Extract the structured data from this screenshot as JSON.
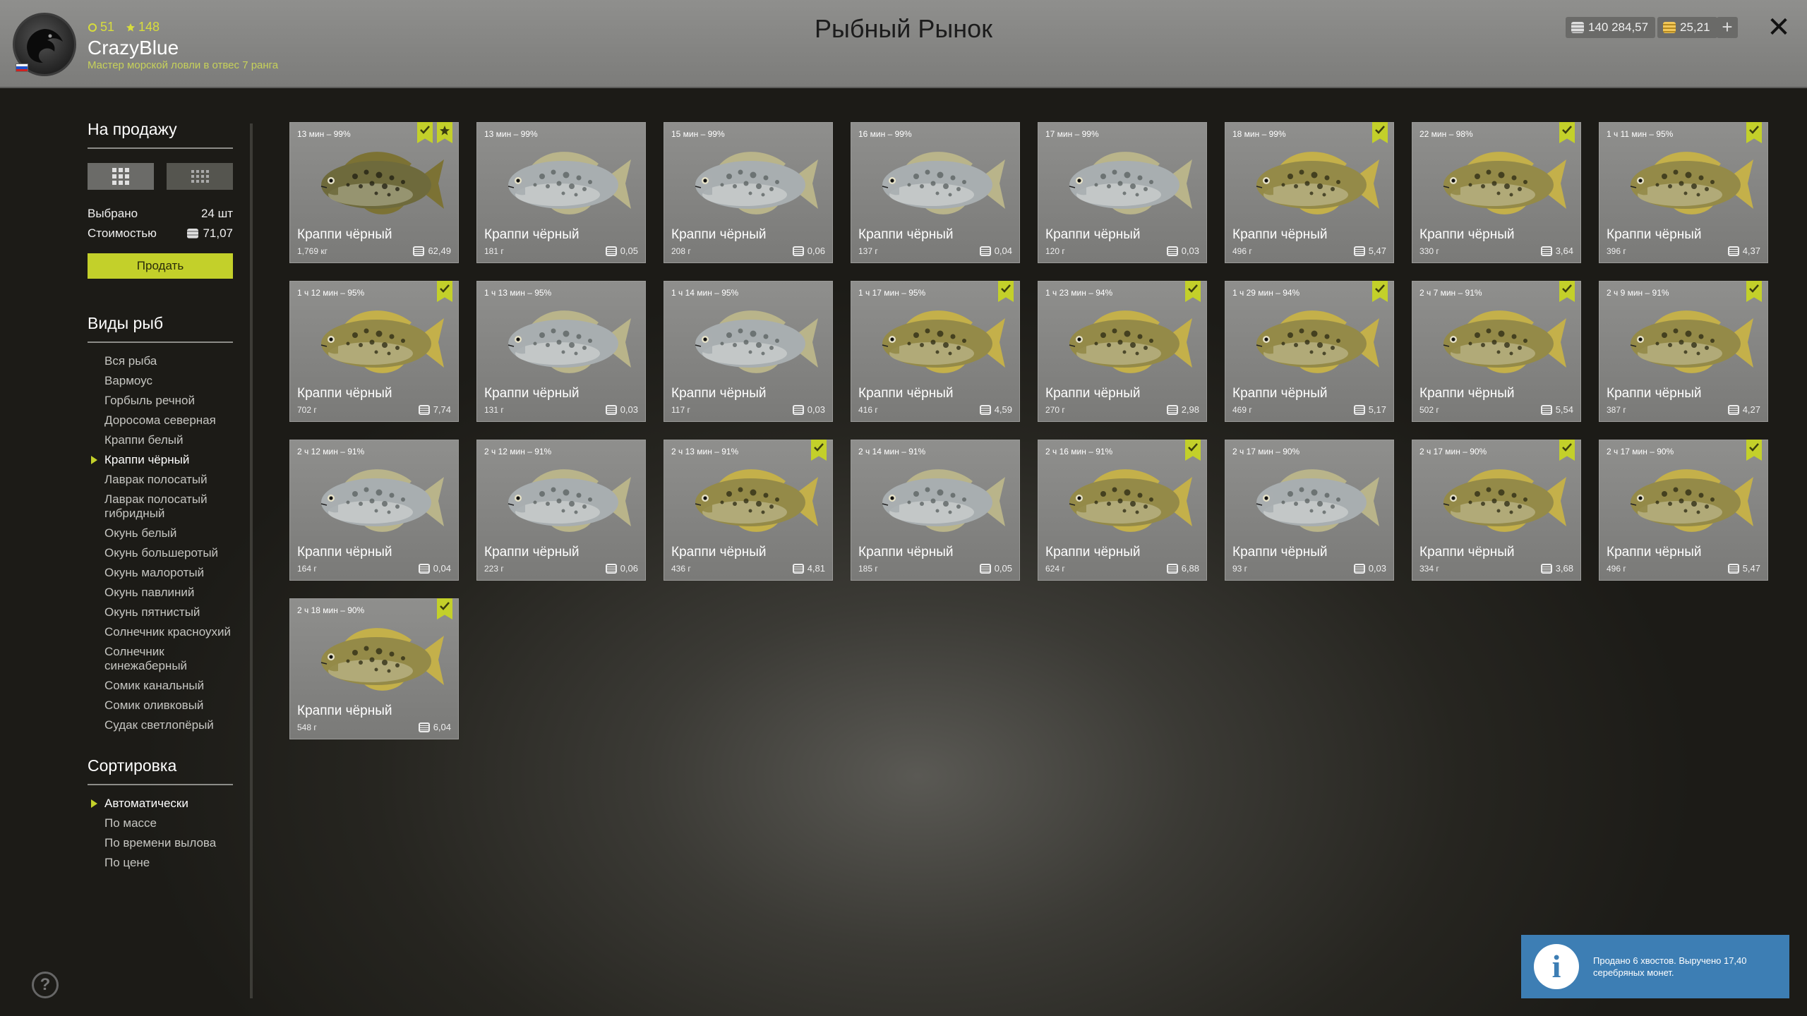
{
  "header": {
    "title": "Рыбный Рынок",
    "username": "CrazyBlue",
    "rank_text": "Мастер морской ловли в отвес 7 ранга",
    "level": "51",
    "stars": "148",
    "silver": "140 284,57",
    "gold": "25,21",
    "plus_label": "+",
    "close_label": "✕"
  },
  "sidebar": {
    "for_sale_title": "На продажу",
    "selected_label": "Выбрано",
    "selected_value": "24 шт",
    "cost_label": "Стоимостью",
    "cost_value": "71,07",
    "sell_label": "Продать",
    "species_title": "Виды рыб",
    "species": [
      {
        "label": "Вся рыба",
        "active": false
      },
      {
        "label": "Вармоус",
        "active": false
      },
      {
        "label": "Горбыль речной",
        "active": false
      },
      {
        "label": "Доросома северная",
        "active": false
      },
      {
        "label": "Краппи белый",
        "active": false
      },
      {
        "label": "Краппи чёрный",
        "active": true
      },
      {
        "label": "Лаврак полосатый",
        "active": false
      },
      {
        "label": "Лаврак полосатый гибридный",
        "active": false
      },
      {
        "label": "Окунь белый",
        "active": false
      },
      {
        "label": "Окунь большеротый",
        "active": false
      },
      {
        "label": "Окунь малоротый",
        "active": false
      },
      {
        "label": "Окунь павлиний",
        "active": false
      },
      {
        "label": "Окунь пятнистый",
        "active": false
      },
      {
        "label": "Солнечник красноухий",
        "active": false
      },
      {
        "label": "Солнечник синежаберный",
        "active": false
      },
      {
        "label": "Сомик канальный",
        "active": false
      },
      {
        "label": "Сомик оливковый",
        "active": false
      },
      {
        "label": "Судак светлопёрый",
        "active": false
      }
    ],
    "sort_title": "Сортировка",
    "sort": [
      {
        "label": "Автоматически",
        "active": true
      },
      {
        "label": "По массе",
        "active": false
      },
      {
        "label": "По времени вылова",
        "active": false
      },
      {
        "label": "По цене",
        "active": false
      }
    ],
    "help_label": "?"
  },
  "fish": [
    {
      "time": "13 мин – 99%",
      "name": "Краппи чёрный",
      "weight": "1,769 кг",
      "price": "62,49",
      "checked": true,
      "star": true,
      "color": "dark"
    },
    {
      "time": "13 мин – 99%",
      "name": "Краппи чёрный",
      "weight": "181 г",
      "price": "0,05",
      "checked": false,
      "star": false,
      "color": "pale"
    },
    {
      "time": "15 мин – 99%",
      "name": "Краппи чёрный",
      "weight": "208 г",
      "price": "0,06",
      "checked": false,
      "star": false,
      "color": "pale"
    },
    {
      "time": "16 мин – 99%",
      "name": "Краппи чёрный",
      "weight": "137 г",
      "price": "0,04",
      "checked": false,
      "star": false,
      "color": "pale"
    },
    {
      "time": "17 мин – 99%",
      "name": "Краппи чёрный",
      "weight": "120 г",
      "price": "0,03",
      "checked": false,
      "star": false,
      "color": "pale"
    },
    {
      "time": "18 мин – 99%",
      "name": "Краппи чёрный",
      "weight": "496 г",
      "price": "5,47",
      "checked": true,
      "star": false,
      "color": "gold"
    },
    {
      "time": "22 мин – 98%",
      "name": "Краппи чёрный",
      "weight": "330 г",
      "price": "3,64",
      "checked": true,
      "star": false,
      "color": "gold"
    },
    {
      "time": "1 ч 11 мин – 95%",
      "name": "Краппи чёрный",
      "weight": "396 г",
      "price": "4,37",
      "checked": true,
      "star": false,
      "color": "gold"
    },
    {
      "time": "1 ч 12 мин – 95%",
      "name": "Краппи чёрный",
      "weight": "702 г",
      "price": "7,74",
      "checked": true,
      "star": false,
      "color": "gold"
    },
    {
      "time": "1 ч 13 мин – 95%",
      "name": "Краппи чёрный",
      "weight": "131 г",
      "price": "0,03",
      "checked": false,
      "star": false,
      "color": "pale"
    },
    {
      "time": "1 ч 14 мин – 95%",
      "name": "Краппи чёрный",
      "weight": "117 г",
      "price": "0,03",
      "checked": false,
      "star": false,
      "color": "pale"
    },
    {
      "time": "1 ч 17 мин – 95%",
      "name": "Краппи чёрный",
      "weight": "416 г",
      "price": "4,59",
      "checked": true,
      "star": false,
      "color": "gold"
    },
    {
      "time": "1 ч 23 мин – 94%",
      "name": "Краппи чёрный",
      "weight": "270 г",
      "price": "2,98",
      "checked": true,
      "star": false,
      "color": "gold"
    },
    {
      "time": "1 ч 29 мин – 94%",
      "name": "Краппи чёрный",
      "weight": "469 г",
      "price": "5,17",
      "checked": true,
      "star": false,
      "color": "gold"
    },
    {
      "time": "2 ч 7 мин – 91%",
      "name": "Краппи чёрный",
      "weight": "502 г",
      "price": "5,54",
      "checked": true,
      "star": false,
      "color": "gold"
    },
    {
      "time": "2 ч 9 мин – 91%",
      "name": "Краппи чёрный",
      "weight": "387 г",
      "price": "4,27",
      "checked": true,
      "star": false,
      "color": "gold"
    },
    {
      "time": "2 ч 12 мин – 91%",
      "name": "Краппи чёрный",
      "weight": "164 г",
      "price": "0,04",
      "checked": false,
      "star": false,
      "color": "pale"
    },
    {
      "time": "2 ч 12 мин – 91%",
      "name": "Краппи чёрный",
      "weight": "223 г",
      "price": "0,06",
      "checked": false,
      "star": false,
      "color": "pale"
    },
    {
      "time": "2 ч 13 мин – 91%",
      "name": "Краппи чёрный",
      "weight": "436 г",
      "price": "4,81",
      "checked": true,
      "star": false,
      "color": "gold"
    },
    {
      "time": "2 ч 14 мин – 91%",
      "name": "Краппи чёрный",
      "weight": "185 г",
      "price": "0,05",
      "checked": false,
      "star": false,
      "color": "pale"
    },
    {
      "time": "2 ч 16 мин – 91%",
      "name": "Краппи чёрный",
      "weight": "624 г",
      "price": "6,88",
      "checked": true,
      "star": false,
      "color": "gold"
    },
    {
      "time": "2 ч 17 мин – 90%",
      "name": "Краппи чёрный",
      "weight": "93 г",
      "price": "0,03",
      "checked": false,
      "star": false,
      "color": "pale"
    },
    {
      "time": "2 ч 17 мин – 90%",
      "name": "Краппи чёрный",
      "weight": "334 г",
      "price": "3,68",
      "checked": true,
      "star": false,
      "color": "gold"
    },
    {
      "time": "2 ч 17 мин – 90%",
      "name": "Краппи чёрный",
      "weight": "496 г",
      "price": "5,47",
      "checked": true,
      "star": false,
      "color": "gold"
    },
    {
      "time": "2 ч 18 мин – 90%",
      "name": "Краппи чёрный",
      "weight": "548 г",
      "price": "6,04",
      "checked": true,
      "star": false,
      "color": "gold"
    }
  ],
  "notification": {
    "icon": "info-icon",
    "text": "Продано 6 хвостов. Выручено 17,40 серебряных монет."
  },
  "colors": {
    "accent": "#c3d02a",
    "notice": "#3d7eb4"
  }
}
